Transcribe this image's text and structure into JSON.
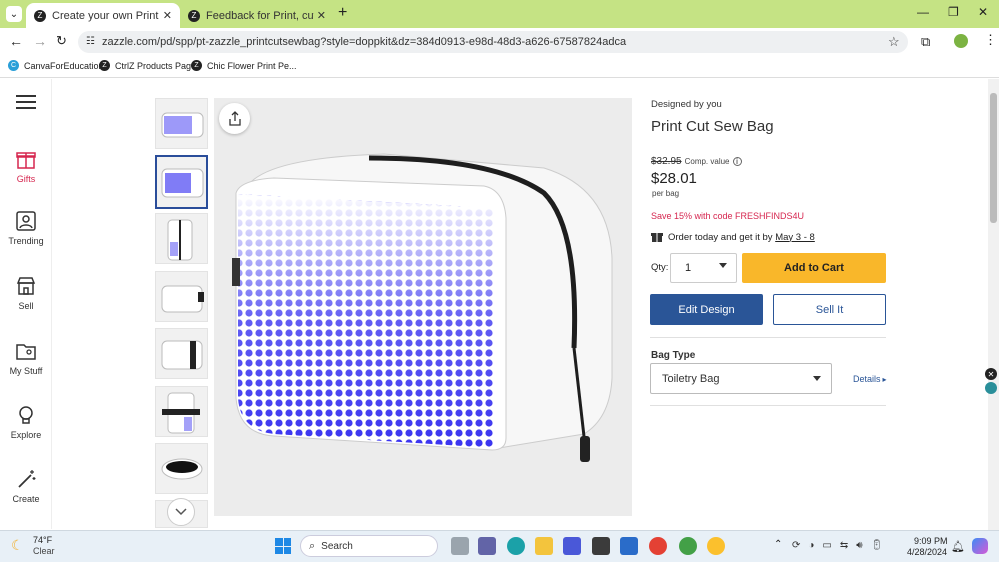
{
  "browser": {
    "tabs": [
      {
        "title": "Create your own Print Cut Sew",
        "active": true
      },
      {
        "title": "Feedback for Print, cut & sew b",
        "active": false
      }
    ],
    "url": "zazzle.com/pd/spp/pt-zazzle_printcutsewbag?style=doppkit&dz=384d0913-e98d-48d3-a626-67587824adca",
    "bookmarks": [
      "CanvaForEducation",
      "CtrlZ Products Page",
      "Chic Flower Print Pe..."
    ]
  },
  "leftnav": {
    "items": [
      {
        "label": "Gifts",
        "icon": "gift-icon",
        "color": "#d6264f"
      },
      {
        "label": "Trending",
        "icon": "trending-icon",
        "color": "#333333"
      },
      {
        "label": "Sell",
        "icon": "store-icon",
        "color": "#333333"
      },
      {
        "label": "My Stuff",
        "icon": "folder-user-icon",
        "color": "#333333"
      },
      {
        "label": "Explore",
        "icon": "lightbulb-icon",
        "color": "#333333"
      },
      {
        "label": "Create",
        "icon": "magic-wand-icon",
        "color": "#333333"
      }
    ]
  },
  "product": {
    "designer": "Designed by you",
    "title": "Print Cut Sew Bag",
    "compare_price": "$32.95",
    "compare_label": "Comp. value",
    "price": "$28.01",
    "unit": "per bag",
    "promo": "Save 15% with code FRESHFINDS4U",
    "delivery_prefix": "Order today and get it by ",
    "delivery_date": "May 3 - 8",
    "qty_label": "Qty:",
    "qty_value": "1",
    "add_to_cart": "Add to Cart",
    "edit_design": "Edit Design",
    "sell_it": "Sell It",
    "bag_type_label": "Bag Type",
    "bag_type_value": "Toiletry Bag",
    "details_link": "Details"
  },
  "colors": {
    "accent_yellow": "#f9b72a",
    "primary_blue": "#2a5597",
    "promo_red": "#d6264f",
    "dot_blue": "#3a34f0"
  },
  "taskbar": {
    "weather_temp": "74°F",
    "weather_desc": "Clear",
    "search_placeholder": "Search",
    "time": "9:09 PM",
    "date": "4/28/2024"
  }
}
